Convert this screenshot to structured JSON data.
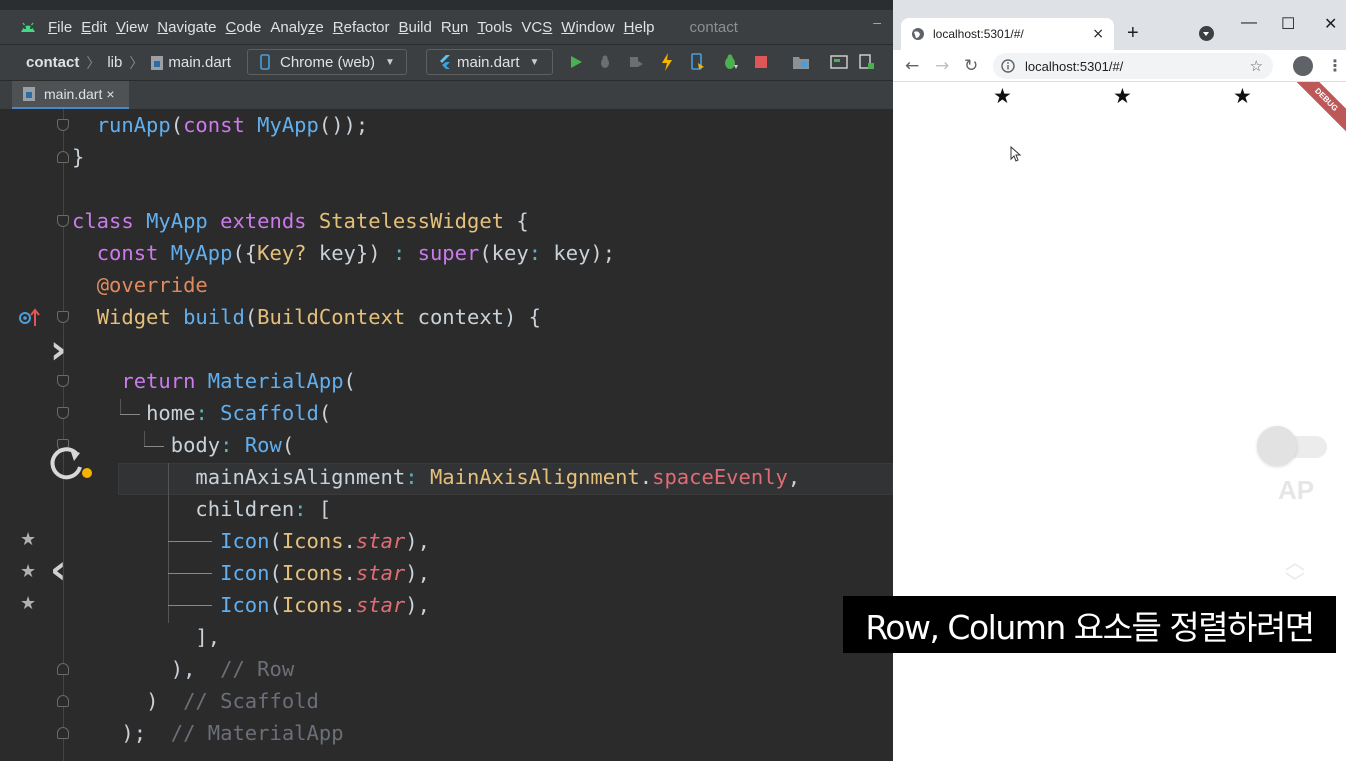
{
  "ide": {
    "menu": [
      {
        "pre": "",
        "u": "F",
        "post": "ile"
      },
      {
        "pre": "",
        "u": "E",
        "post": "dit"
      },
      {
        "pre": "",
        "u": "V",
        "post": "iew"
      },
      {
        "pre": "",
        "u": "N",
        "post": "avigate"
      },
      {
        "pre": "",
        "u": "C",
        "post": "ode"
      },
      {
        "pre": "Analy",
        "u": "z",
        "post": "e"
      },
      {
        "pre": "",
        "u": "R",
        "post": "efactor"
      },
      {
        "pre": "",
        "u": "B",
        "post": "uild"
      },
      {
        "pre": "R",
        "u": "u",
        "post": "n"
      },
      {
        "pre": "",
        "u": "T",
        "post": "ools"
      },
      {
        "pre": "VC",
        "u": "S",
        "post": ""
      },
      {
        "pre": "",
        "u": "W",
        "post": "indow"
      },
      {
        "pre": "",
        "u": "H",
        "post": "elp"
      }
    ],
    "project_title": "contact",
    "minimize": "–",
    "breadcrumb": {
      "project": "contact",
      "folder": "lib",
      "file": "main.dart"
    },
    "device_selector": "Chrome (web)",
    "run_config": "main.dart",
    "open_tab": "main.dart",
    "tab_close": "×",
    "code": {
      "l1": {
        "a": "runApp",
        "b": "(",
        "c": "const",
        "d": " ",
        "e": "MyApp",
        "f": "());"
      },
      "l2": {
        "a": "}"
      },
      "l4": {
        "a": "class",
        "b": " ",
        "c": "MyApp",
        "d": " ",
        "e": "extends",
        "f": " ",
        "g": "StatelessWidget",
        "h": " {"
      },
      "l5": {
        "a": "const",
        "b": " ",
        "c": "MyApp",
        "d": "({",
        "e": "Key?",
        "f": " key}) ",
        "g": ":",
        "h": " ",
        "i": "super",
        "j": "(key",
        "k": ":",
        "m": " key);"
      },
      "l6": {
        "a": "@override"
      },
      "l7": {
        "a": "Widget",
        "b": " ",
        "c": "build",
        "d": "(",
        "e": "BuildContext",
        "f": " context) {"
      },
      "l9": {
        "a": "return",
        "b": " ",
        "c": "MaterialApp",
        "d": "("
      },
      "l10": {
        "a": "home",
        "b": ": ",
        "c": "Scaffold",
        "d": "("
      },
      "l11": {
        "a": "body",
        "b": ": ",
        "c": "Row",
        "d": "("
      },
      "l12": {
        "a": "mainAxisAlignment",
        "b": ": ",
        "c": "MainAxisAlignment",
        "d": ".",
        "e": "spaceEvenly",
        "f": ","
      },
      "l13": {
        "a": "children",
        "b": ": ["
      },
      "l14": {
        "a": "Icon",
        "b": "(",
        "c": "Icons",
        "d": ".",
        "e": "star",
        "f": "),"
      },
      "l15": {
        "a": "Icon",
        "b": "(",
        "c": "Icons",
        "d": ".",
        "e": "star",
        "f": "),"
      },
      "l16": {
        "a": "Icon",
        "b": "(",
        "c": "Icons",
        "d": ".",
        "e": "star",
        "f": "),"
      },
      "l17": {
        "a": "],"
      },
      "l18": {
        "a": "),",
        "b": "  // Row"
      },
      "l19": {
        "a": ")",
        "b": "  // Scaffold"
      },
      "l20": {
        "a": ");",
        "b": "  // MaterialApp"
      }
    },
    "gutter_stars": [
      "★",
      "★",
      "★"
    ],
    "overlay_next": "›",
    "overlay_prev": "‹"
  },
  "browser": {
    "tab_title": "localhost:5301/#/",
    "tab_close": "×",
    "new_tab": "+",
    "window_controls": [
      "—",
      "☐",
      "✕"
    ],
    "back": "←",
    "forward": "→",
    "reload": "↻",
    "url": "localhost:5301/#/",
    "bookmark": "☆",
    "menu": "⋮",
    "app_stars": [
      "★",
      "★",
      "★"
    ],
    "debug_banner": "DEBUG",
    "overlay_label": "AP",
    "scroll_up": "︿",
    "scroll_down": "﹀"
  },
  "subtitle": "Row, Column 요소들 정렬하려면",
  "colors": {
    "keyword": "#cc7aed",
    "function": "#61afef",
    "type": "#e5c07b",
    "annotation": "#e08a5e",
    "comment": "#6b6f78",
    "property": "#e06c75",
    "run_green": "#4caf50",
    "stop_red": "#e05555"
  }
}
